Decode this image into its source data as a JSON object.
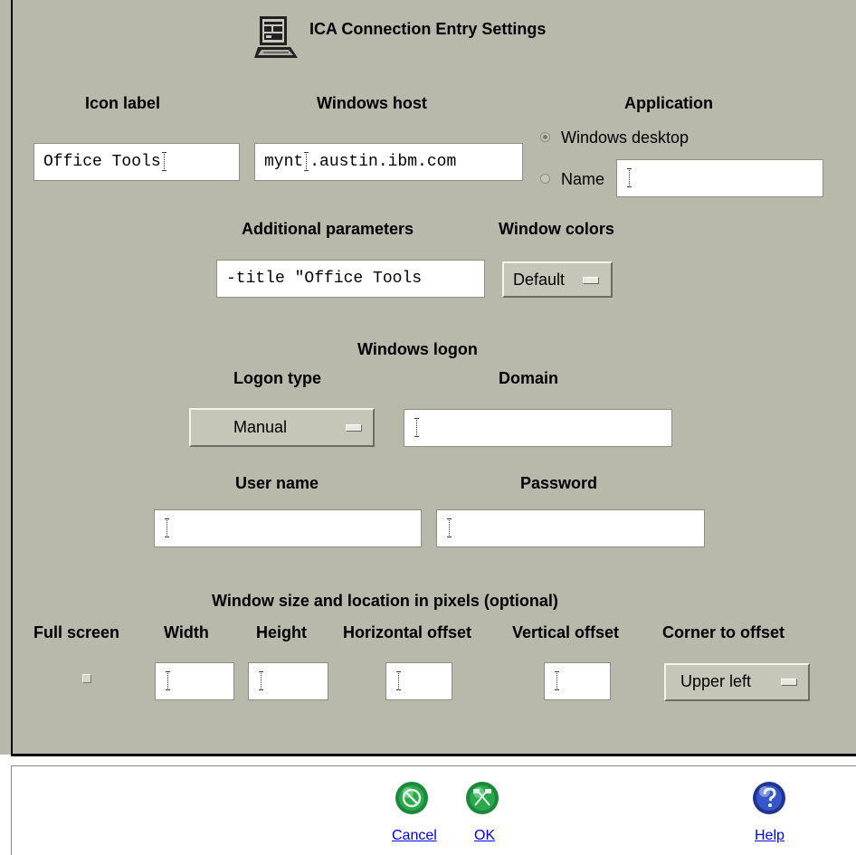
{
  "dialog": {
    "title": "ICA Connection Entry Settings"
  },
  "connection": {
    "icon_label": {
      "label": "Icon label",
      "value": "Office Tools"
    },
    "windows_host": {
      "label": "Windows host",
      "value_prefix": "mynt",
      "value_suffix": ".austin.ibm.com"
    },
    "application": {
      "label": "Application",
      "options": [
        {
          "label": "Windows desktop",
          "selected": true
        },
        {
          "label": "Name",
          "selected": false
        }
      ],
      "name_value": ""
    },
    "additional_parameters": {
      "label": "Additional parameters",
      "value": "-title \"Office Tools"
    },
    "window_colors": {
      "label": "Window colors",
      "selected": "Default"
    }
  },
  "logon": {
    "heading": "Windows logon",
    "logon_type": {
      "label": "Logon type",
      "selected": "Manual"
    },
    "domain": {
      "label": "Domain",
      "value": ""
    },
    "user_name": {
      "label": "User name",
      "value": ""
    },
    "password": {
      "label": "Password",
      "value": ""
    }
  },
  "window_size": {
    "heading": "Window size and location in pixels (optional)",
    "full_screen": {
      "label": "Full screen",
      "checked": false
    },
    "width": {
      "label": "Width",
      "value": ""
    },
    "height": {
      "label": "Height",
      "value": ""
    },
    "horizontal_offset": {
      "label": "Horizontal offset",
      "value": ""
    },
    "vertical_offset": {
      "label": "Vertical offset",
      "value": ""
    },
    "corner_to_offset": {
      "label": "Corner to offset",
      "selected": "Upper left"
    }
  },
  "footer": {
    "cancel": {
      "label": "Cancel",
      "icon": "cancel-icon",
      "color": "#1a8a3a"
    },
    "ok": {
      "label": "OK",
      "icon": "ok-icon",
      "color": "#1a8a3a"
    },
    "help": {
      "label": "Help",
      "icon": "help-icon",
      "color": "#2844a8"
    }
  }
}
